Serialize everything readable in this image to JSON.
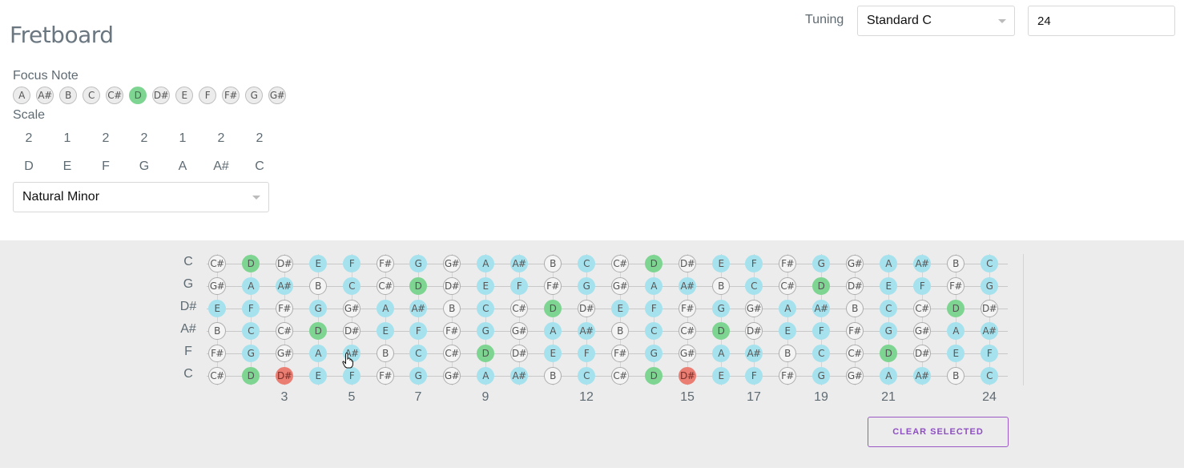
{
  "app": {
    "title": "Fretboard"
  },
  "tuning": {
    "label": "Tuning",
    "selected": "Standard C",
    "fret_count": "24"
  },
  "focus": {
    "label": "Focus Note",
    "notes": [
      "A",
      "A#",
      "B",
      "C",
      "C#",
      "D",
      "D#",
      "E",
      "F",
      "F#",
      "G",
      "G#"
    ],
    "active": "D"
  },
  "scale": {
    "label": "Scale",
    "intervals": [
      "2",
      "1",
      "2",
      "2",
      "1",
      "2",
      "2"
    ],
    "notes": [
      "D",
      "E",
      "F",
      "G",
      "A",
      "A#",
      "C"
    ],
    "selected": "Natural Minor"
  },
  "fretboard": {
    "strings": [
      "C",
      "G",
      "D#",
      "A#",
      "F",
      "C"
    ],
    "chromatic": [
      "A",
      "A#",
      "B",
      "C",
      "C#",
      "D",
      "D#",
      "E",
      "F",
      "F#",
      "G",
      "G#"
    ],
    "frets": 24,
    "markers": [
      "3",
      "5",
      "7",
      "9",
      "12",
      "15",
      "17",
      "19",
      "21",
      "24"
    ],
    "selected_cells": [
      {
        "string": 5,
        "fret": 3
      },
      {
        "string": 5,
        "fret": 15
      }
    ]
  },
  "actions": {
    "clear_label": "CLEAR SELECTED"
  },
  "colors": {
    "root": "#7ed592",
    "in_scale": "#a6e2ee",
    "selected": "#ea7e72",
    "out_of_scale": "#f4f4f4",
    "button_accent": "#8e4fc0",
    "fretboard_background": "#ececec"
  },
  "icons": {
    "tuning_caret": "chevron-down-icon",
    "scale_caret": "chevron-down-icon",
    "pointer": "hand-cursor-icon"
  }
}
